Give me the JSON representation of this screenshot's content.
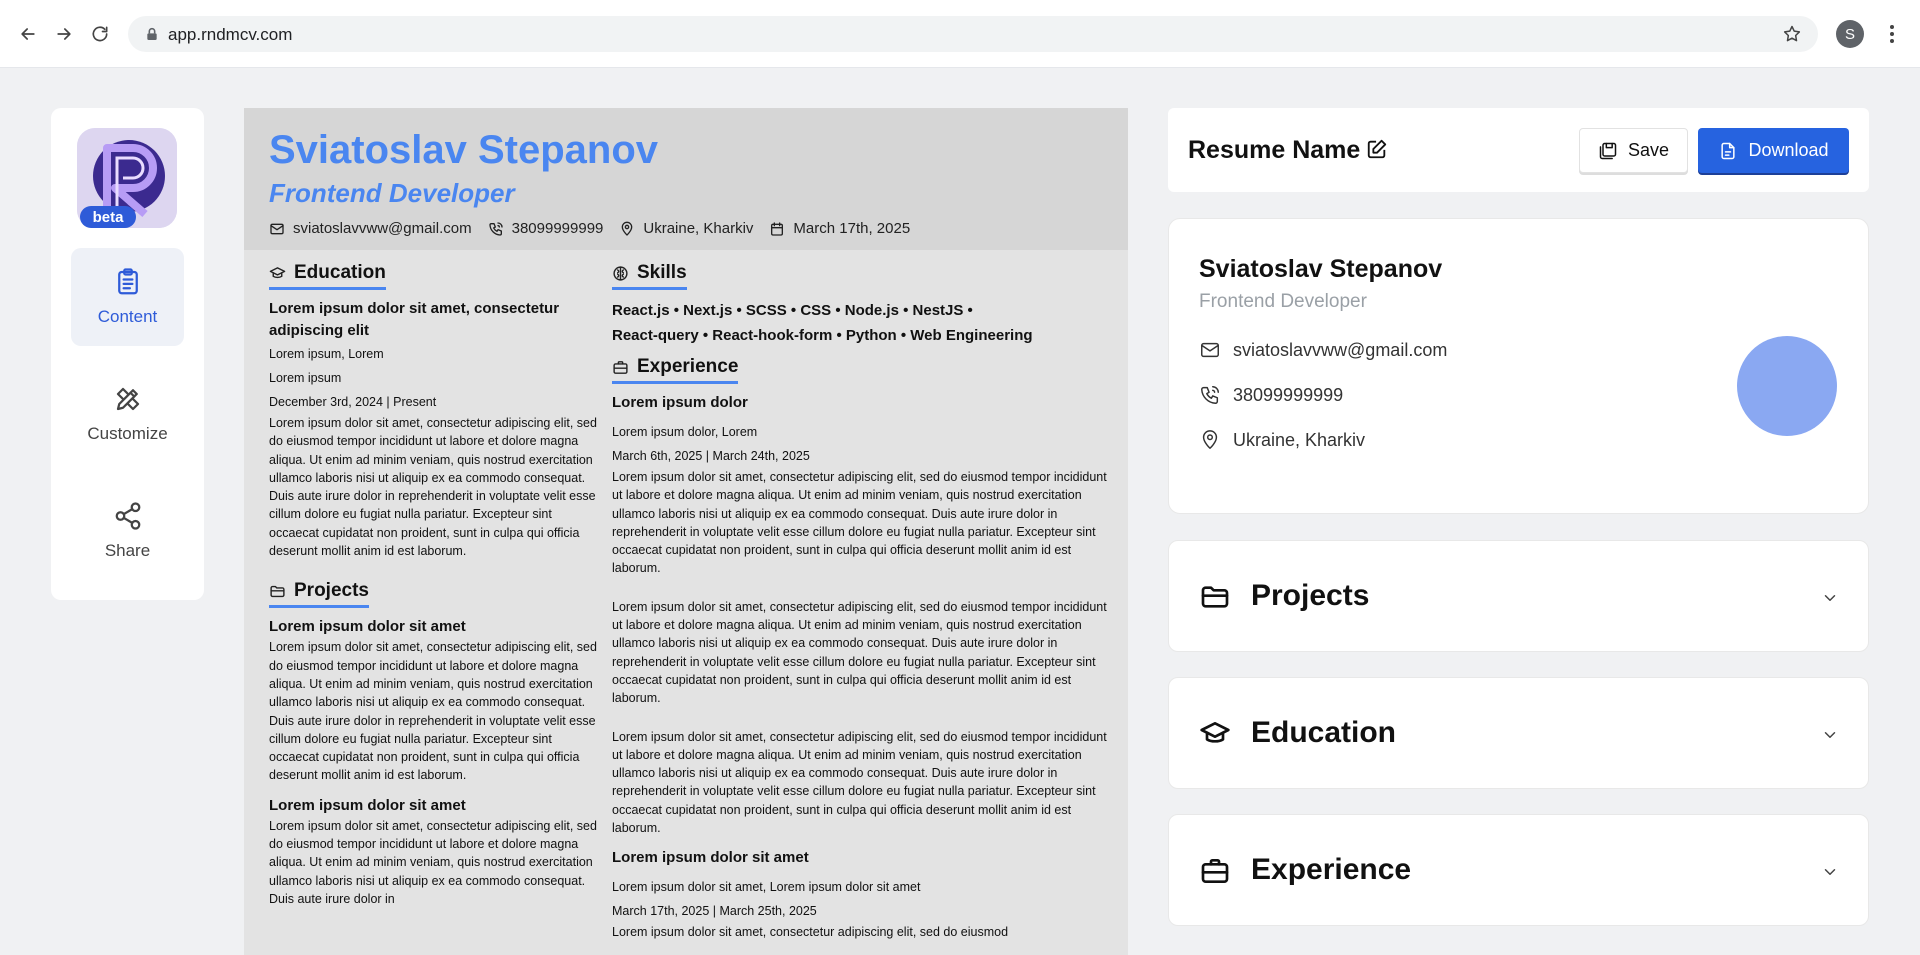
{
  "browser": {
    "url": "app.rndmcv.com",
    "profile_initial": "S"
  },
  "sidebar": {
    "badge": "beta",
    "items": [
      {
        "label": "Content"
      },
      {
        "label": "Customize"
      },
      {
        "label": "Share"
      }
    ]
  },
  "resume": {
    "name": "Sviatoslav Stepanov",
    "title": "Frontend Developer",
    "email": "sviatoslavvww@gmail.com",
    "phone": "38099999999",
    "location": "Ukraine, Kharkiv",
    "date": "March 17th, 2025",
    "education": {
      "heading": "Education",
      "entry_title": "Lorem ipsum dolor sit amet, consectetur adipiscing elit",
      "entry_sub1": "Lorem ipsum, Lorem",
      "entry_sub2": "Lorem ipsum",
      "entry_dates": "December 3rd, 2024 | Present",
      "entry_desc": "Lorem ipsum dolor sit amet, consectetur adipiscing elit, sed do eiusmod tempor incididunt ut labore et dolore magna aliqua. Ut enim ad minim veniam, quis nostrud exercitation ullamco laboris nisi ut aliquip ex ea commodo consequat. Duis aute irure dolor in reprehenderit in voluptate velit esse cillum dolore eu fugiat nulla pariatur. Excepteur sint occaecat cupidatat non proident, sunt in culpa qui officia deserunt mollit anim id est laborum."
    },
    "projects": {
      "heading": "Projects",
      "p1_title": "Lorem ipsum dolor sit amet",
      "p1_desc": "Lorem ipsum dolor sit amet, consectetur adipiscing elit, sed do eiusmod tempor incididunt ut labore et dolore magna aliqua. Ut enim ad minim veniam, quis nostrud exercitation ullamco laboris nisi ut aliquip ex ea commodo consequat. Duis aute irure dolor in reprehenderit in voluptate velit esse cillum dolore eu fugiat nulla pariatur. Excepteur sint occaecat cupidatat non proident, sunt in culpa qui officia deserunt mollit anim id est laborum.",
      "p2_title": "Lorem ipsum dolor sit amet",
      "p2_desc": "Lorem ipsum dolor sit amet, consectetur adipiscing elit, sed do eiusmod tempor incididunt ut labore et dolore magna aliqua. Ut enim ad minim veniam, quis nostrud exercitation ullamco laboris nisi ut aliquip ex ea commodo consequat. Duis aute irure dolor in"
    },
    "skills": {
      "heading": "Skills",
      "line1": "React.js  •  Next.js  •  SCSS  •  CSS  •  Node.js  •  NestJS  •",
      "line2": "React-query  •  React-hook-form  •  Python  •  Web Engineering"
    },
    "experience": {
      "heading": "Experience",
      "e1_title": "Lorem ipsum dolor",
      "e1_sub": "Lorem ipsum dolor, Lorem",
      "e1_dates": "March 6th, 2025 | March 24th, 2025",
      "e1_desc1": "Lorem ipsum dolor sit amet, consectetur adipiscing elit, sed do eiusmod tempor incididunt ut labore et dolore magna aliqua. Ut enim ad minim veniam, quis nostrud exercitation ullamco laboris nisi ut aliquip ex ea commodo consequat. Duis aute irure dolor in reprehenderit in voluptate velit esse cillum dolore eu fugiat nulla pariatur. Excepteur sint occaecat cupidatat non proident, sunt in culpa qui officia deserunt mollit anim id est laborum.",
      "e1_desc2": "Lorem ipsum dolor sit amet, consectetur adipiscing elit, sed do eiusmod tempor incididunt ut labore et dolore magna aliqua. Ut enim ad minim veniam, quis nostrud exercitation ullamco laboris nisi ut aliquip ex ea commodo consequat. Duis aute irure dolor in reprehenderit in voluptate velit esse cillum dolore eu fugiat nulla pariatur. Excepteur sint occaecat cupidatat non proident, sunt in culpa qui officia deserunt mollit anim id est laborum.",
      "e1_desc3": "Lorem ipsum dolor sit amet, consectetur adipiscing elit, sed do eiusmod tempor incididunt ut labore et dolore magna aliqua. Ut enim ad minim veniam, quis nostrud exercitation ullamco laboris nisi ut aliquip ex ea commodo consequat. Duis aute irure dolor in reprehenderit in voluptate velit esse cillum dolore eu fugiat nulla pariatur. Excepteur sint occaecat cupidatat non proident, sunt in culpa qui officia deserunt mollit anim id est laborum.",
      "e2_title": "Lorem ipsum dolor sit amet",
      "e2_sub": "Lorem ipsum dolor sit amet, Lorem ipsum dolor sit amet",
      "e2_dates": "March 17th, 2025 | March 25th, 2025",
      "e2_desc": "Lorem ipsum dolor sit amet, consectetur adipiscing elit, sed do eiusmod"
    }
  },
  "editor": {
    "resume_name": "Resume Name",
    "save_label": "Save",
    "download_label": "Download",
    "profile": {
      "name": "Sviatoslav Stepanov",
      "title": "Frontend Developer",
      "email": "sviatoslavvww@gmail.com",
      "phone": "38099999999",
      "location": "Ukraine, Kharkiv"
    },
    "sections": [
      {
        "label": "Projects"
      },
      {
        "label": "Education"
      },
      {
        "label": "Experience"
      }
    ]
  },
  "colors": {
    "accent": "#4a86f0",
    "primary_button": "#2663e0",
    "avatar": "#8aa8f2"
  }
}
